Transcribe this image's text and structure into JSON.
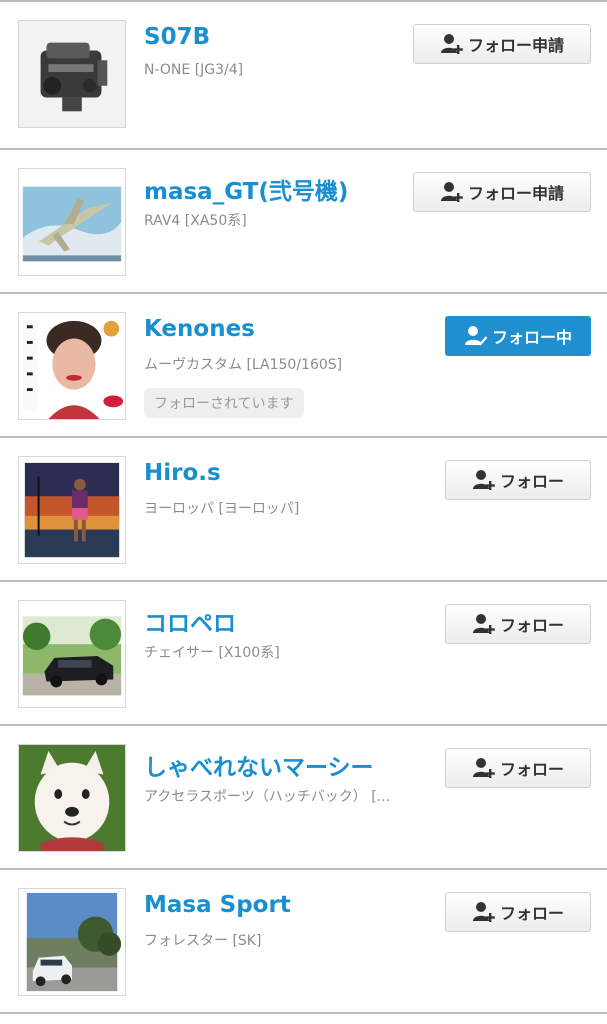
{
  "users": [
    {
      "name": "S07B",
      "car": "N-ONE [JG3/4]",
      "button": "フォロー申請",
      "button_type": "request",
      "avatar": "engine-image",
      "followed_badge": ""
    },
    {
      "name": "masa_GT(弐号機)",
      "car": "RAV4 [XA50系]",
      "button": "フォロー申請",
      "button_type": "request",
      "avatar": "jet-fighter-image",
      "followed_badge": ""
    },
    {
      "name": "Kenones",
      "car": "ムーヴカスタム [LA150/160S]",
      "button": "フォロー中",
      "button_type": "following",
      "avatar": "woman-portrait-image",
      "followed_badge": "フォローされています"
    },
    {
      "name": "Hiro.s",
      "car": "ヨーロッパ [ヨーロッパ]",
      "button": "フォロー",
      "button_type": "follow",
      "avatar": "person-sunset-image",
      "followed_badge": ""
    },
    {
      "name": "コロペロ",
      "car": "チェイサー [X100系]",
      "button": "フォロー",
      "button_type": "follow",
      "avatar": "dark-sedan-image",
      "followed_badge": ""
    },
    {
      "name": "しゃべれないマーシー",
      "car": "アクセラスポーツ（ハッチバック） [...",
      "button": "フォロー",
      "button_type": "follow",
      "avatar": "white-dog-image",
      "followed_badge": ""
    },
    {
      "name": "Masa Sport",
      "car": "フォレスター [SK]",
      "button": "フォロー",
      "button_type": "follow",
      "avatar": "white-suv-image",
      "followed_badge": ""
    }
  ],
  "colors": {
    "accent": "#1a8fd0",
    "following_bg": "#1f8fd0",
    "muted": "#8c8c8c"
  }
}
